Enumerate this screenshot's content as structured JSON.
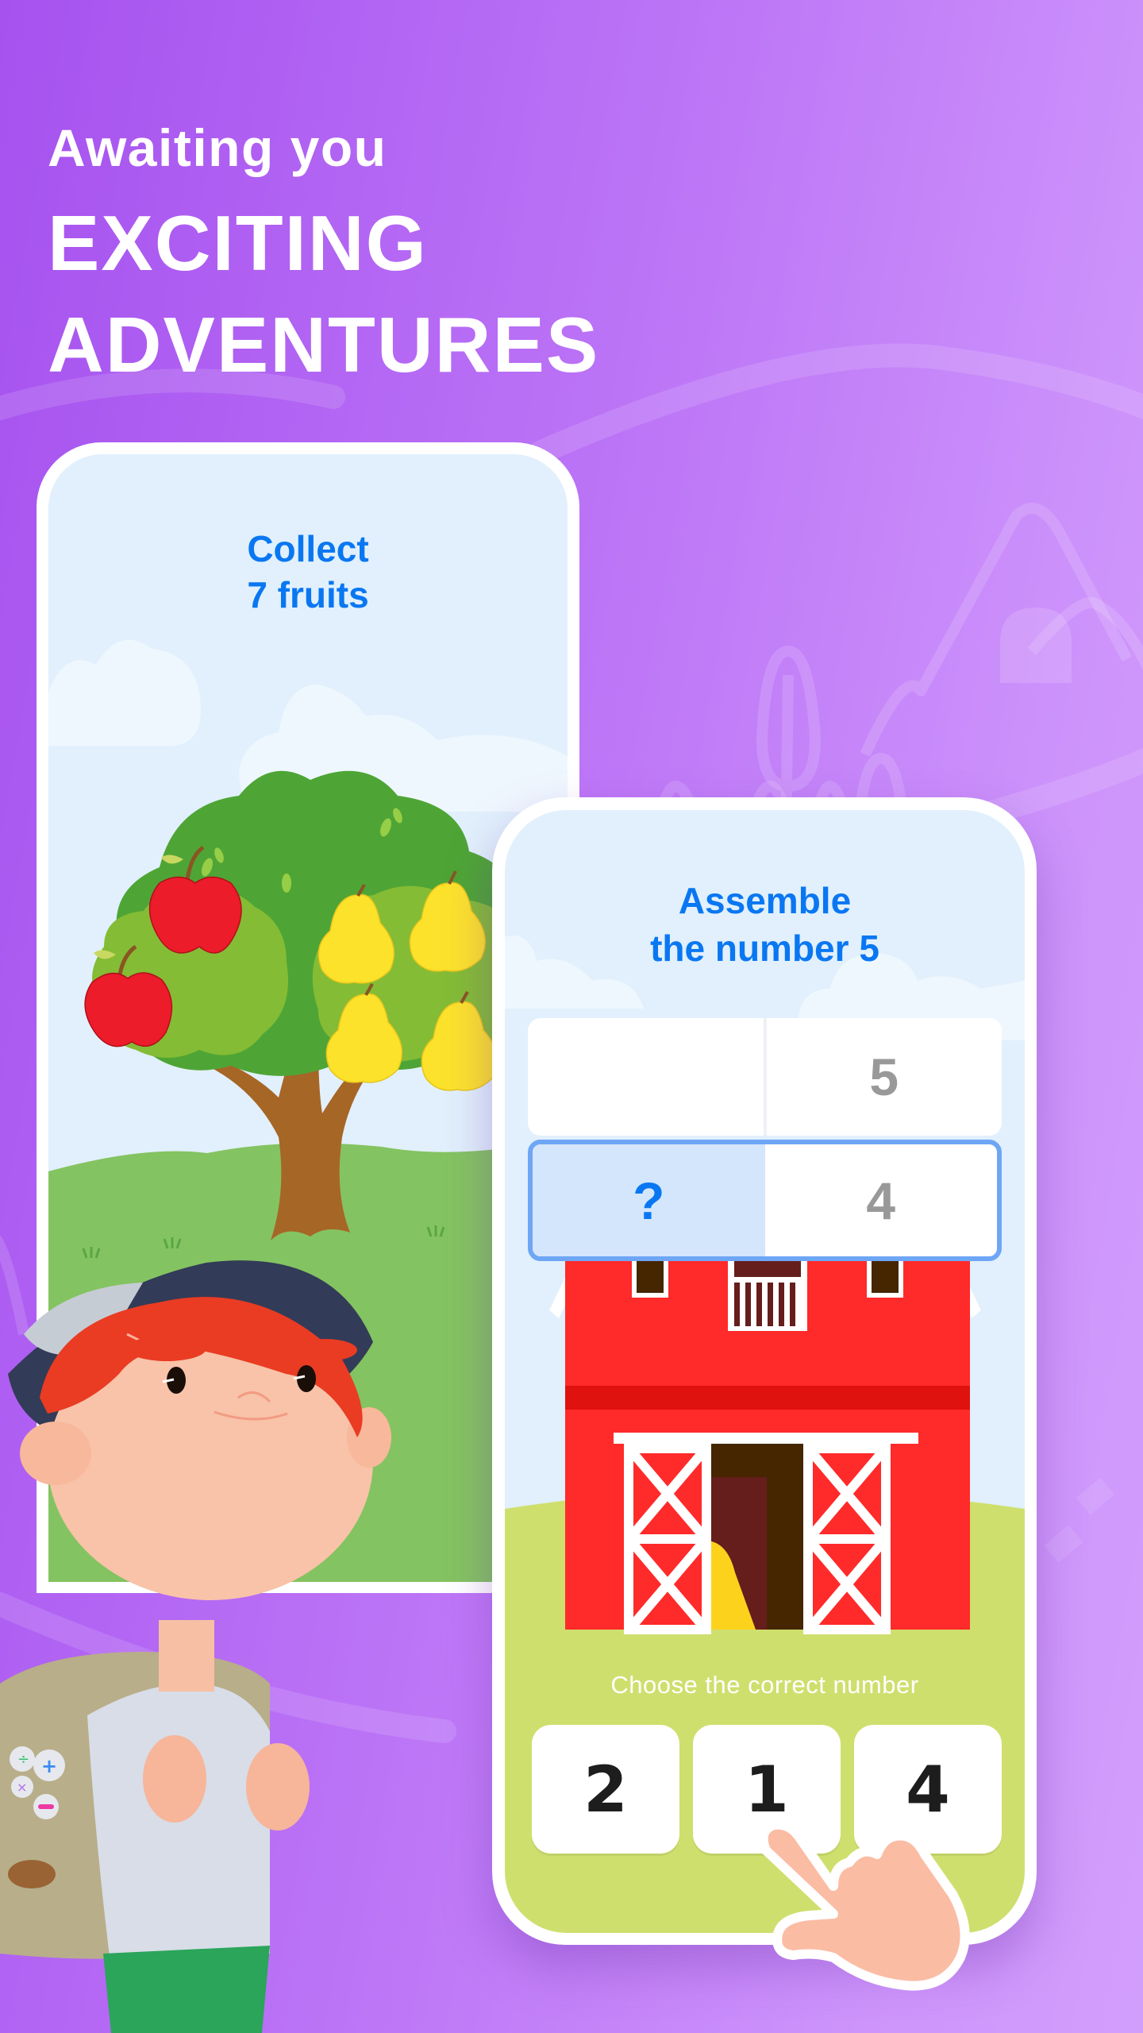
{
  "headline": {
    "line1": "Awaiting you",
    "line2": "EXCITING",
    "line3": "ADVENTURES"
  },
  "left_phone": {
    "title_line1": "Collect",
    "title_line2": "7 fruits",
    "fruits": {
      "apples": 2,
      "pears_visible": 4
    }
  },
  "right_phone": {
    "title_line1": "Assemble",
    "title_line2": "the number 5",
    "grid": [
      {
        "left": "",
        "right": "5"
      },
      {
        "left": "?",
        "right": "4",
        "selected": true
      }
    ],
    "instruction": "Choose the correct number",
    "choices": [
      "2",
      "1",
      "4"
    ]
  },
  "colors": {
    "accent_blue": "#0a77f2",
    "selected_border": "#6ea6f6",
    "selected_fill": "#d4e6fb",
    "number_gray": "#999999",
    "barn_red": "#ff2a2a",
    "grass": "#cfdf6e",
    "bg_left": "#a652ef",
    "bg_right": "#d29efc"
  }
}
